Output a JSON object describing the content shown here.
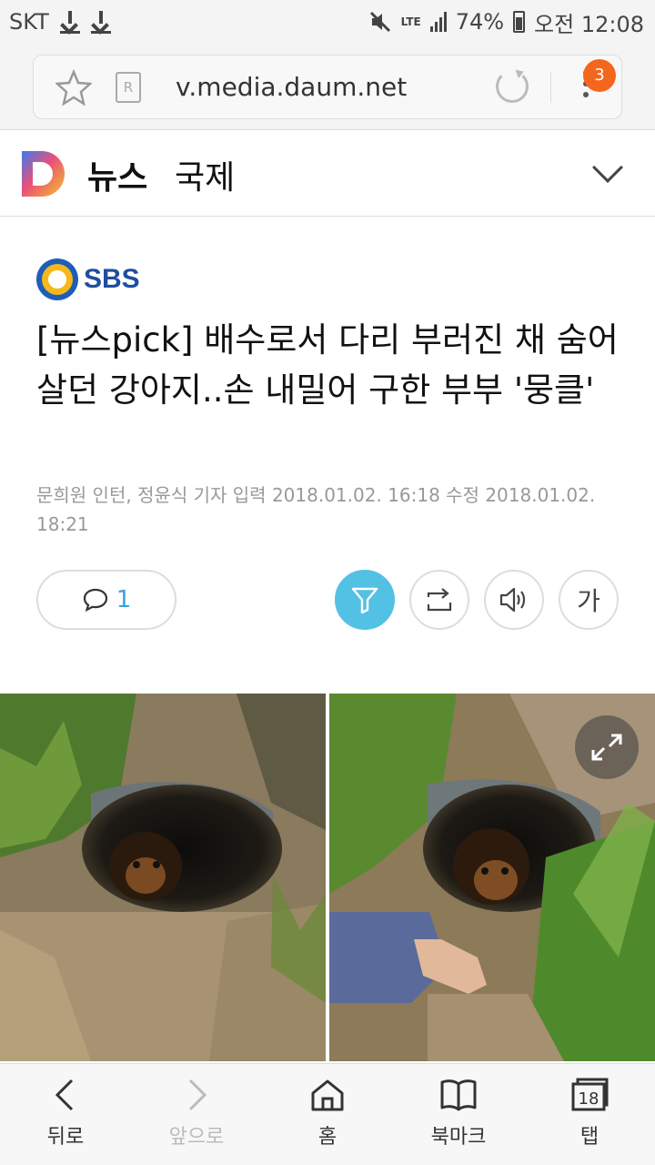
{
  "status_bar": {
    "carrier": "SKT",
    "network": "LTE",
    "battery": "74%",
    "time": "오전 12:08"
  },
  "browser": {
    "url": "v.media.daum.net",
    "tab_badge_count": "3",
    "reader_glyph": "R"
  },
  "header": {
    "title": "뉴스",
    "section": "국제"
  },
  "article": {
    "source": "SBS",
    "headline": "[뉴스pick] 배수로서 다리 부러진 채 숨어 살던 강아지..손 내밀어 구한 부부 '뭉클'",
    "byline": "문희원 인턴, 정윤식 기자  입력 2018.01.02. 16:18  수정 2018.01.02. 18:21",
    "comment_count": "1",
    "font_button_label": "가"
  },
  "toolbar": {
    "back": "뒤로",
    "forward": "앞으로",
    "home": "홈",
    "bookmarks": "북마크",
    "tabs": "탭",
    "tabs_count": "18"
  },
  "colors": {
    "accent": "#53c1e3",
    "badge": "#f4661b",
    "sbs_blue": "#1f5db8",
    "sbs_yellow": "#f5b81a"
  },
  "icons": [
    "star-icon",
    "reader-icon",
    "reload-icon",
    "menu-icon",
    "chevron-down-icon",
    "comment-icon",
    "filter-icon",
    "share-icon",
    "speaker-icon",
    "expand-icon",
    "back-icon",
    "forward-icon",
    "home-icon",
    "bookmark-icon",
    "tabs-icon"
  ]
}
